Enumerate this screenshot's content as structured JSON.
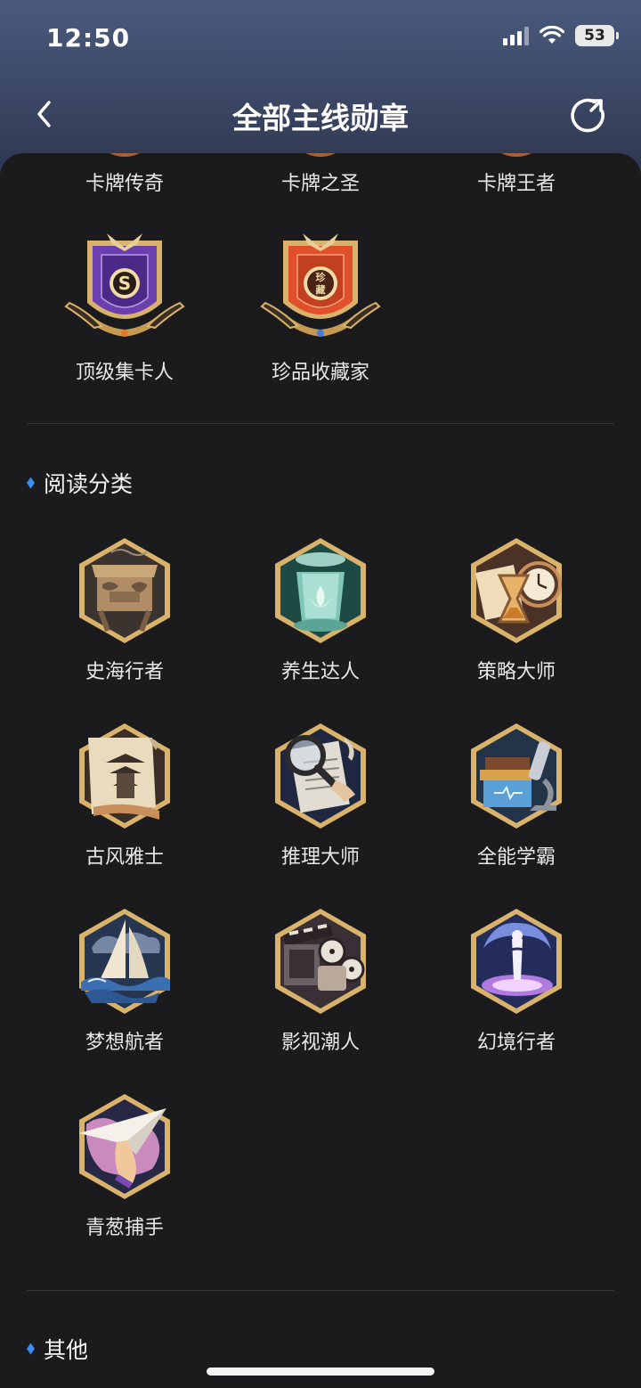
{
  "status_bar": {
    "time": "12:50",
    "battery": "53"
  },
  "nav": {
    "title": "全部主线勋章"
  },
  "colors": {
    "accent": "#3d8df5",
    "background": "#1b1b1d",
    "header": "#4a5a7d",
    "gold": "#d9b36c"
  },
  "card_medals": {
    "top_row": [
      {
        "label": "卡牌传奇"
      },
      {
        "label": "卡牌之圣"
      },
      {
        "label": "卡牌王者"
      }
    ],
    "second_row": [
      {
        "label": "顶级集卡人",
        "icon": "collector-medal-icon",
        "badge_text": "S"
      },
      {
        "label": "珍品收藏家",
        "icon": "treasure-collector-medal-icon",
        "badge_text": "珍藏"
      }
    ]
  },
  "reading_section": {
    "title": "阅读分类",
    "medals": [
      {
        "label": "史海行者",
        "icon": "bronze-cauldron-icon"
      },
      {
        "label": "养生达人",
        "icon": "lotus-tea-icon"
      },
      {
        "label": "策略大师",
        "icon": "hourglass-clock-icon"
      },
      {
        "label": "古风雅士",
        "icon": "pagoda-scroll-icon"
      },
      {
        "label": "推理大师",
        "icon": "magnifier-icon"
      },
      {
        "label": "全能学霸",
        "icon": "microscope-books-icon"
      },
      {
        "label": "梦想航者",
        "icon": "sailboat-waves-icon"
      },
      {
        "label": "影视潮人",
        "icon": "film-projector-icon"
      },
      {
        "label": "幻境行者",
        "icon": "portal-figure-icon"
      },
      {
        "label": "青葱捕手",
        "icon": "paper-plane-hand-icon"
      }
    ]
  },
  "other_section": {
    "title": "其他"
  }
}
